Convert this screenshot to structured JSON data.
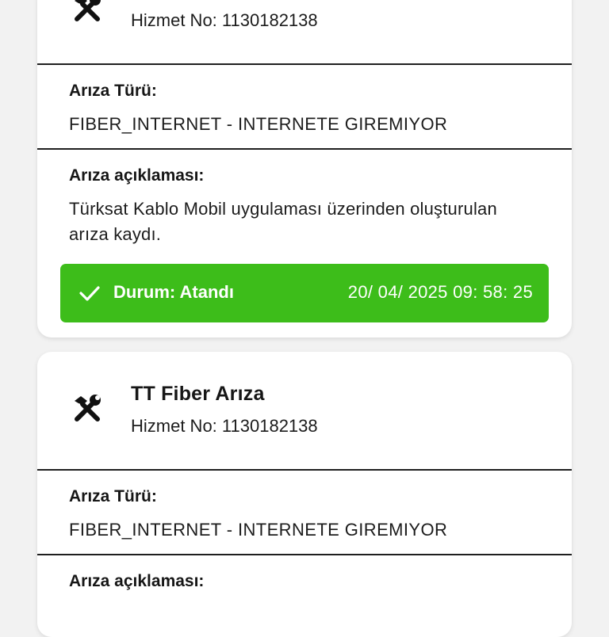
{
  "cards": [
    {
      "title": "",
      "service_no": "Hizmet No: 1130182138",
      "fault_type_label": "Arıza Türü:",
      "fault_type_value": "FIBER_INTERNET -  INTERNETE GIREMIYOR",
      "description_label": "Arıza açıklaması:",
      "description_text": "Türksat Kablo Mobil uygulaması üzerinden oluşturulan arıza kaydı.",
      "status_text": "Durum: Atandı",
      "status_datetime": "20/ 04/ 2025 09: 58: 25"
    },
    {
      "title": "TT Fiber Arıza",
      "service_no": "Hizmet No: 1130182138",
      "fault_type_label": "Arıza Türü:",
      "fault_type_value": "FIBER_INTERNET -  INTERNETE GIREMIYOR",
      "description_label": "Arıza açıklaması:"
    }
  ],
  "icons": {
    "card_icon": "tools-icon",
    "status_icon": "check-icon"
  },
  "colors": {
    "status_green": "#3dbd1a",
    "divider": "#1f1f1f",
    "background": "#f2f2f2"
  }
}
